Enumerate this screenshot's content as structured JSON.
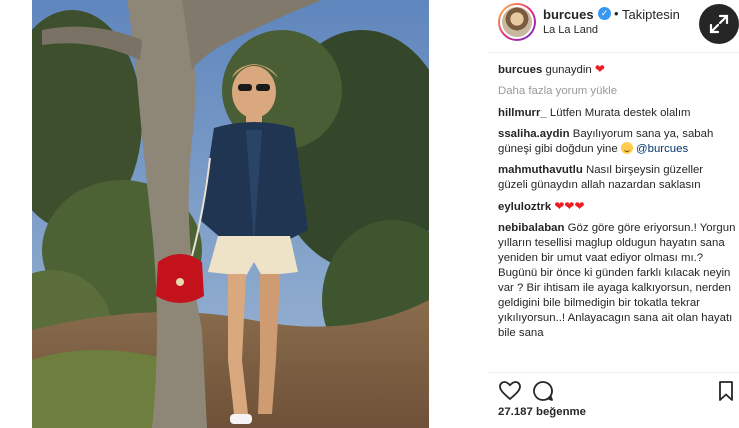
{
  "post": {
    "username": "burcues",
    "separator": "•",
    "follow_status": "Takiptesin",
    "location": "La La Land",
    "verified_mark": "✓",
    "likes": "27.187 beğenme"
  },
  "caption": {
    "user": "burcues",
    "text": "gunaydin"
  },
  "load_more": "Daha fazla yorum yükle",
  "comments": [
    {
      "user": "hillmurr_",
      "text": "Lütfen Murata destek olalım"
    },
    {
      "user": "ssaliha.aydin",
      "text": "Bayılıyorum sana ya, sabah güneşi gibi doğdun yine",
      "mention": "@burcues"
    },
    {
      "user": "mahmuthavutlu",
      "text": "Nasıl birşeysin güzeller güzeli günaydın allah nazardan saklasın"
    },
    {
      "user": "eyluloztrk",
      "text": ""
    },
    {
      "user": "nebibalaban",
      "text": "Göz göre göre eriyorsun.! Yorgun yılların tesellisi maglup oldugun hayatın sana yeniden bir umut vaat ediyor olması mı.? Bugünü bir önce ki günden farklı kılacak neyin var ? Bir ihtisam ile ayaga kalkıyorsun, nerden geldigini bile bilmedigin bir tokatla tekrar yıkılıyorsun..! Anlayacagın sana ait olan hayatı bile sana"
    }
  ],
  "colors": {
    "accent_blue": "#3897f0",
    "heart_red": "#ed1b24",
    "muted_text": "#999999",
    "text": "#262626"
  },
  "icons": {
    "expand": "expand-arrows-icon",
    "like": "heart-outline-icon",
    "comment": "comment-bubble-icon",
    "save": "bookmark-icon"
  }
}
